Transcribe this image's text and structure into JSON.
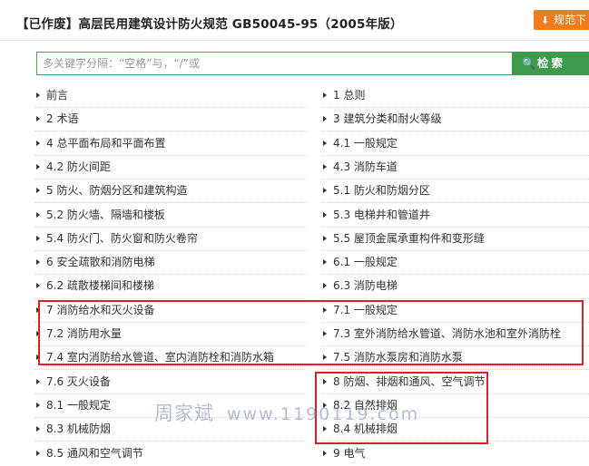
{
  "header": {
    "title": "【已作废】高层民用建筑设计防火规范 GB50045-95（2005年版）",
    "download_label": "规范下",
    "download_icon": "download-icon"
  },
  "search": {
    "placeholder": "多关键字分隔：“空格”与，“/”或",
    "value": "",
    "button_label": "检索",
    "button_icon": "search-icon"
  },
  "toc": {
    "left": [
      "前言",
      "2 术语",
      "4 总平面布局和平面布置",
      "4.2 防火间距",
      "5 防火、防烟分区和建筑构造",
      "5.2 防火墙、隔墙和楼板",
      "5.4 防火门、防火窗和防火卷帘",
      "6 安全疏散和消防电梯",
      "6.2 疏散楼梯间和楼梯",
      "7 消防给水和灭火设备",
      "7.2 消防用水量",
      "7.4 室内消防给水管道、室内消防栓和消防水箱",
      "7.6 灭火设备",
      "8.1 一般规定",
      "8.3 机械防烟",
      "8.5 通风和空气调节"
    ],
    "right": [
      "1 总则",
      "3 建筑分类和耐火等级",
      "4.1 一般规定",
      "4.3 消防车道",
      "5.1 防火和防烟分区",
      "5.3 电梯井和管道井",
      "5.5 屋顶金属承重构件和变形缝",
      "6.1 一般规定",
      "6.3 消防电梯",
      "7.1 一般规定",
      "7.3 室外消防给水管道、消防水池和室外消防栓",
      "7.5 消防水泵房和消防水泵",
      "8 防烟、排烟和通风、空气调节",
      "8.2 自然排烟",
      "8.4 机械排烟",
      "9 电气"
    ]
  },
  "highlight_color": "#d9232b",
  "accent_color": "#3d9b4c",
  "download_color": "#f07c1e",
  "watermark": {
    "name": "周家斌",
    "url": "www.1190119.com"
  }
}
